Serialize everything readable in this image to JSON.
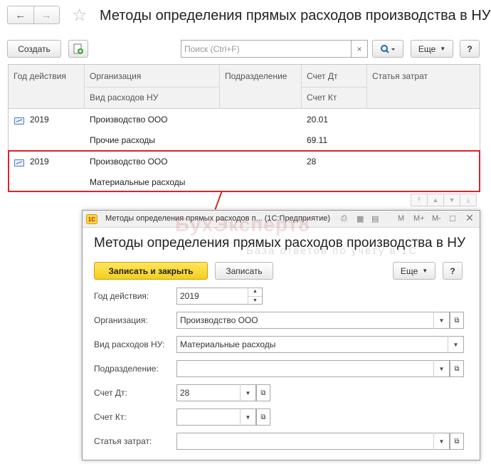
{
  "main": {
    "title": "Методы определения прямых расходов производства в НУ",
    "nav_back_icon": "arrow-left-icon",
    "nav_forward_icon": "arrow-right-icon",
    "favorite_icon": "star-icon",
    "toolbar": {
      "create_label": "Создать",
      "copy_icon": "copy-add-icon",
      "search_placeholder": "Поиск (Ctrl+F)",
      "clear_glyph": "×",
      "search_icon": "magnifier-icon",
      "more_label": "Еще",
      "help_label": "?"
    },
    "table": {
      "headers": {
        "year": "Год действия",
        "org": "Организация",
        "expense_type": "Вид расходов НУ",
        "department": "Подразделение",
        "debit": "Счет Дт",
        "credit": "Счет Кт",
        "cost_item": "Статья затрат"
      },
      "rows": [
        {
          "year": "2019",
          "org": "Производство ООО",
          "expense_type": "Прочие расходы",
          "debit": "20.01",
          "credit": "69.11"
        },
        {
          "year": "2019",
          "org": "Производство ООО",
          "expense_type": "Материальные расходы",
          "debit": "28",
          "credit": ""
        }
      ]
    }
  },
  "dialog": {
    "window_title": "Методы определения прямых расходов п... (1С:Предприятие)",
    "logo_text": "1С",
    "watermark": "БухЭксперт8",
    "watermark_sub": "База ответов по учету в 1С",
    "titlebar_icons": {
      "m": "M",
      "mplus": "M+",
      "mminus": "M-"
    },
    "title": "Методы определения прямых расходов производства в НУ",
    "buttons": {
      "save_close": "Записать и закрыть",
      "save": "Записать",
      "more": "Еще",
      "help": "?"
    },
    "fields": {
      "year": {
        "label": "Год действия:",
        "value": "2019"
      },
      "org": {
        "label": "Организация:",
        "value": "Производство ООО"
      },
      "expense_type": {
        "label": "Вид расходов НУ:",
        "value": "Материальные расходы"
      },
      "department": {
        "label": "Подразделение:",
        "value": ""
      },
      "debit": {
        "label": "Счет Дт:",
        "value": "28"
      },
      "credit": {
        "label": "Счет Кт:",
        "value": ""
      },
      "cost_item": {
        "label": "Статья затрат:",
        "value": ""
      }
    }
  },
  "colors": {
    "highlight": "#d9232b",
    "primary_button": "#f5cf1f"
  }
}
